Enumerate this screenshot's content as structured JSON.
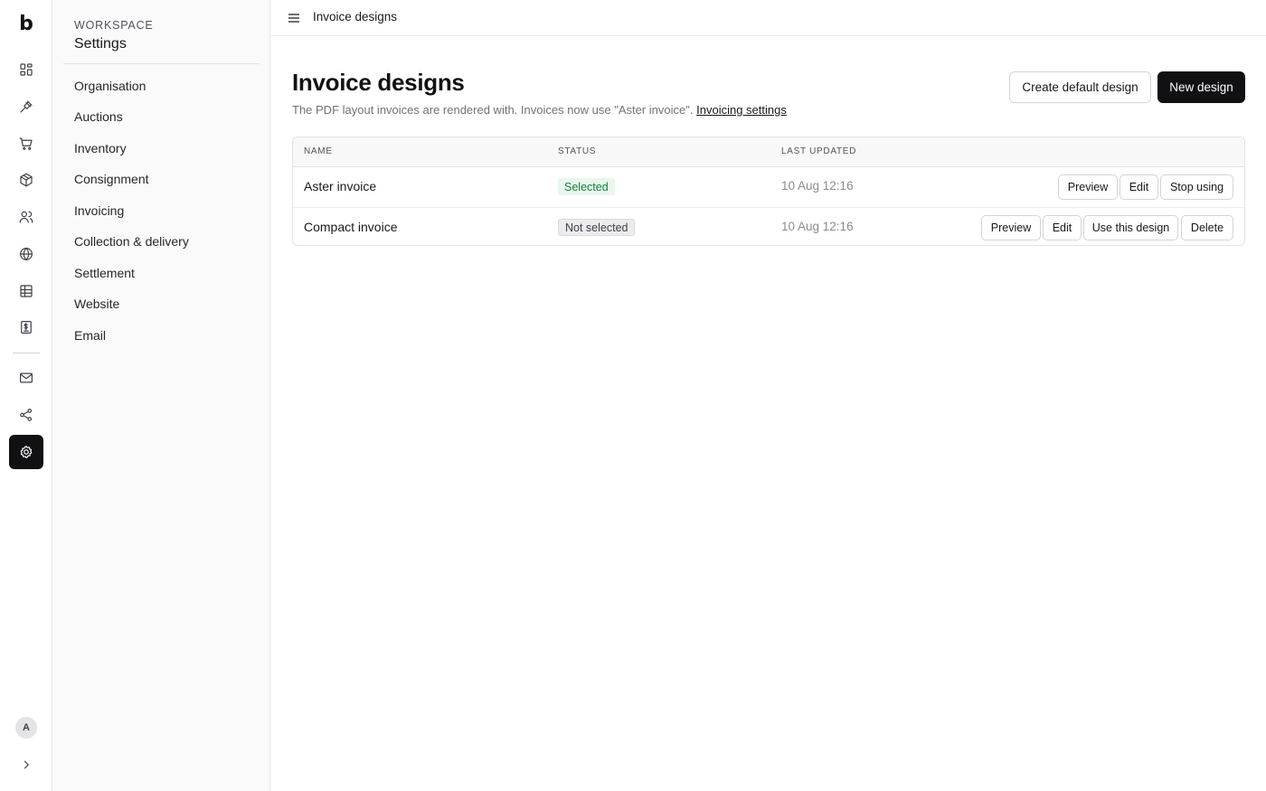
{
  "rail": {
    "logo": "b",
    "icons": [
      "dashboard-icon",
      "gavel-icon",
      "cart-icon",
      "box-icon",
      "users-icon",
      "globe-icon",
      "table-icon",
      "invoice-icon",
      "mail-icon",
      "share-icon",
      "gear-icon"
    ],
    "active": "gear-icon",
    "avatar": "A"
  },
  "settings_nav": {
    "section_label": "WORKSPACE",
    "title": "Settings",
    "items": [
      "Organisation",
      "Auctions",
      "Inventory",
      "Consignment",
      "Invoicing",
      "Collection & delivery",
      "Settlement",
      "Website",
      "Email"
    ]
  },
  "topbar": {
    "breadcrumb": "Invoice designs"
  },
  "page": {
    "title": "Invoice designs",
    "subtitle": "The PDF layout invoices are rendered with. Invoices now use \"Aster invoice\".",
    "subtitle_link": "Invoicing settings",
    "create_default_label": "Create default design",
    "new_design_label": "New design"
  },
  "table": {
    "headers": {
      "name": "NAME",
      "status": "STATUS",
      "updated": "LAST UPDATED"
    },
    "rows": [
      {
        "name": "Aster invoice",
        "status": "Selected",
        "updated": "10 Aug 12:16",
        "actions": [
          "Preview",
          "Edit",
          "Stop using"
        ]
      },
      {
        "name": "Compact invoice",
        "status": "Not selected",
        "updated": "10 Aug 12:16",
        "actions": [
          "Preview",
          "Edit",
          "Use this design",
          "Delete"
        ]
      }
    ]
  },
  "colors": {
    "accent": "#111113",
    "selected_badge": "#15803d",
    "selected_badge_bg": "#e8f7ee"
  }
}
